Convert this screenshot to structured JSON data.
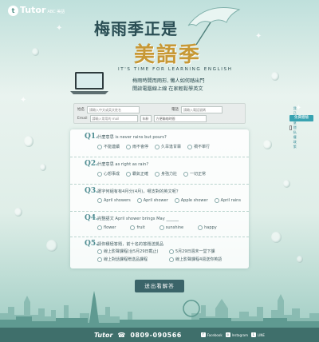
{
  "brand": {
    "logo_text": "Tutor",
    "logo_sub": "ABC 美語"
  },
  "hero": {
    "title_line1": "梅雨季正是",
    "title_line2": "美語季",
    "tagline": "IT'S TIME FOR LEARNING ENGLISH",
    "subtitle1": "梅雨時間而雨形,  懶人如何踏出門",
    "subtitle2": "開啟電腦線上線  在家輕鬆學英文"
  },
  "form": {
    "name_label": "姓名",
    "name_placeholder": "請輸入中文或英文姓名",
    "phone_label": "電話",
    "phone_placeholder": "請輸入電話號碼",
    "email_label": "Email",
    "email_placeholder": "請輸入常用的 mail",
    "agree_text": "我已同意隱私權政策",
    "age_select": "年齡",
    "time_select": "方便聯絡時間",
    "submit": "免費體驗"
  },
  "quiz": [
    {
      "num": "Q1.",
      "question": "什麼意思 is never rains but pours?",
      "options": [
        "不能連續",
        "雨不會停",
        "久旱逢甘霖",
        "禍不單行"
      ]
    },
    {
      "num": "Q2.",
      "question": "什麼意思 as right as rain?",
      "options": [
        "心想事成",
        "霸氣正確",
        "身強力壯",
        "一切正常"
      ]
    },
    {
      "num": "Q3.",
      "question": "選字何組有有4月分(4月)，哪支對的英文呢？",
      "options": [
        "April showers",
        "April shower",
        "Apple shower",
        "April rains"
      ]
    },
    {
      "num": "Q4.",
      "question": "完整語文 April shower brings May ______",
      "options": [
        "flower",
        "fruit",
        "sunshine",
        "happy"
      ]
    },
    {
      "num": "Q5.",
      "question": "請你積極答題，前十名的答題送獎品",
      "options": [
        "線上影聲課程(台5月29日截止)",
        "5月29日週末一堂下課",
        "線上對話課程贈送品課程",
        "線上影聲課程4週送你英語"
      ]
    }
  ],
  "submit_label": "送出看解答",
  "footer": {
    "logo": "Tutor",
    "phone": "0809-090566",
    "social": [
      "Facebook",
      "Instagram",
      "LINE"
    ]
  },
  "colors": {
    "accent": "#39a3b1",
    "gold": "#c79835",
    "dark": "#3b6469"
  }
}
